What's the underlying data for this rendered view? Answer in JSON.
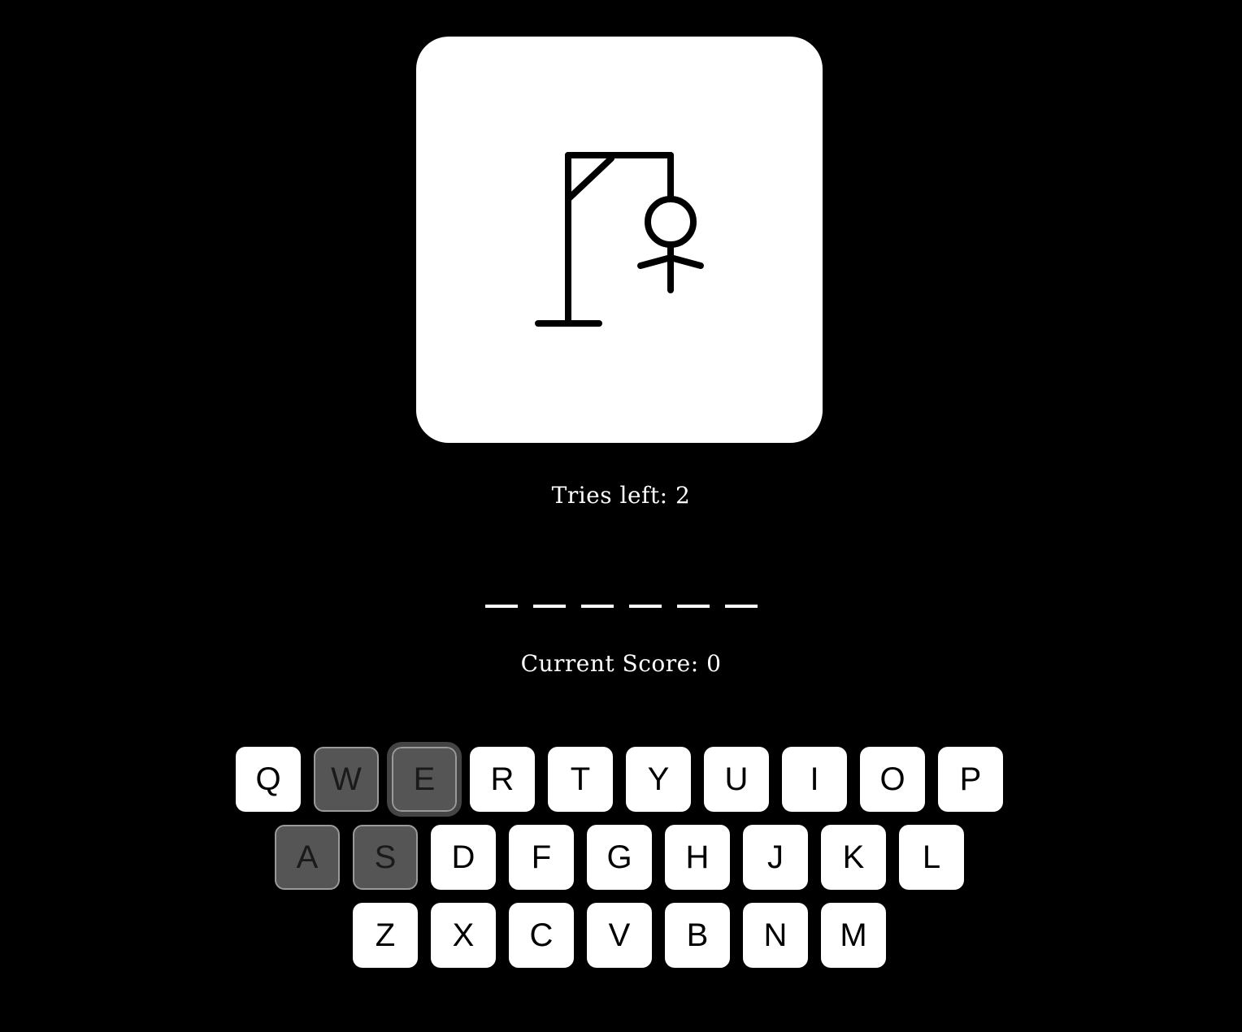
{
  "game": {
    "tries_label": "Tries left:",
    "tries_left": "2",
    "score_label": "Current Score:",
    "score_value": "0",
    "word_blanks": 6
  },
  "keyboard": {
    "row1": [
      {
        "letter": "Q",
        "used": false
      },
      {
        "letter": "W",
        "used": true
      },
      {
        "letter": "E",
        "used": true,
        "focused": true
      },
      {
        "letter": "R",
        "used": false
      },
      {
        "letter": "T",
        "used": false
      },
      {
        "letter": "Y",
        "used": false
      },
      {
        "letter": "U",
        "used": false
      },
      {
        "letter": "I",
        "used": false
      },
      {
        "letter": "O",
        "used": false
      },
      {
        "letter": "P",
        "used": false
      }
    ],
    "row2": [
      {
        "letter": "A",
        "used": true
      },
      {
        "letter": "S",
        "used": true
      },
      {
        "letter": "D",
        "used": false
      },
      {
        "letter": "F",
        "used": false
      },
      {
        "letter": "G",
        "used": false
      },
      {
        "letter": "H",
        "used": false
      },
      {
        "letter": "J",
        "used": false
      },
      {
        "letter": "K",
        "used": false
      },
      {
        "letter": "L",
        "used": false
      }
    ],
    "row3": [
      {
        "letter": "Z",
        "used": false
      },
      {
        "letter": "X",
        "used": false
      },
      {
        "letter": "C",
        "used": false
      },
      {
        "letter": "V",
        "used": false
      },
      {
        "letter": "B",
        "used": false
      },
      {
        "letter": "N",
        "used": false
      },
      {
        "letter": "M",
        "used": false
      }
    ]
  },
  "colors": {
    "background": "#000000",
    "panel": "#ffffff",
    "key": "#ffffff",
    "key_used": "#555555"
  }
}
